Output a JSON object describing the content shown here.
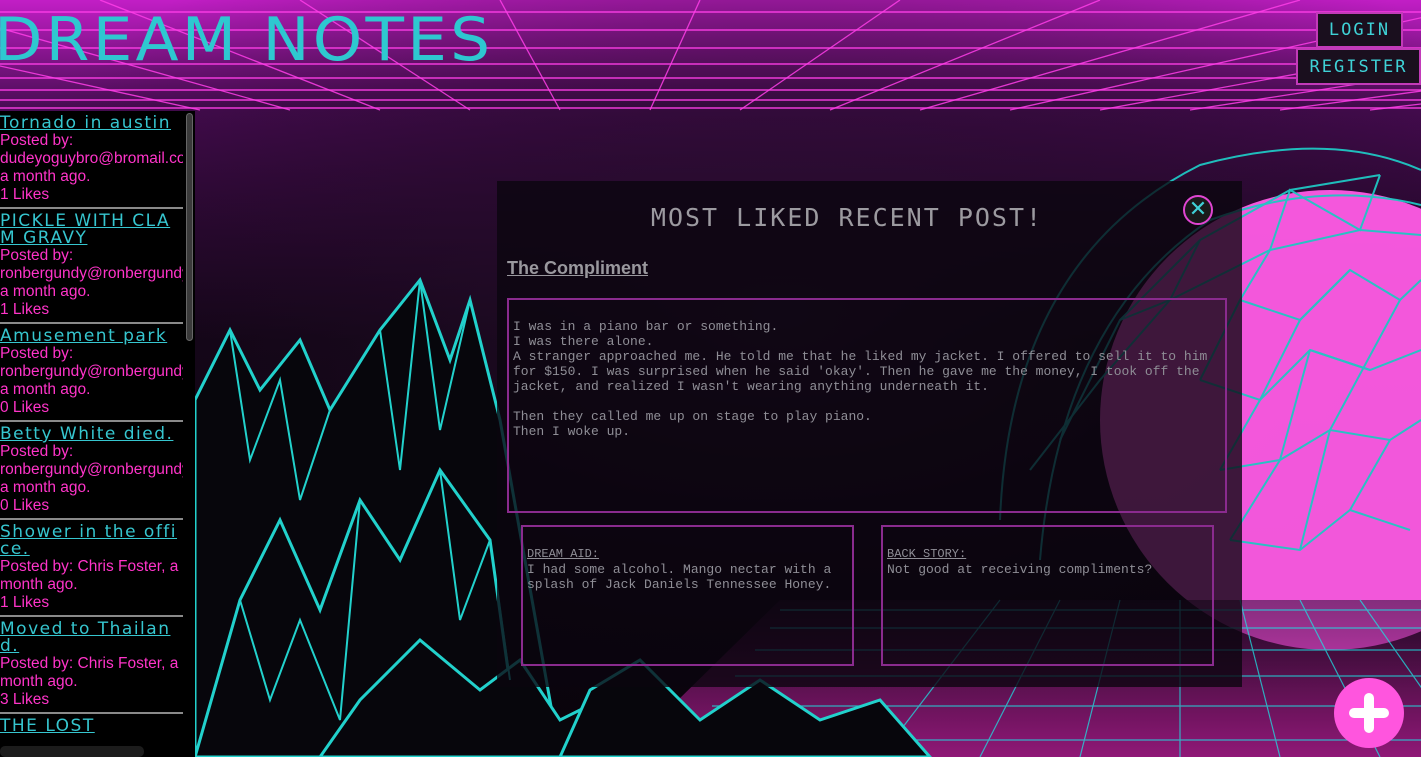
{
  "header": {
    "title": "DREAM NOTES",
    "login_label": "LOGIN",
    "register_label": "REGISTER"
  },
  "sidebar": {
    "posts": [
      {
        "title": "Tornado in austin",
        "meta": [
          "Posted by:",
          "dudeyoguybro@bromail.com,",
          "a month ago.",
          "1 Likes"
        ]
      },
      {
        "title": "PICKLE WITH CLAM GRAVY",
        "meta": [
          "Posted by:",
          "ronbergundy@ronbergundy.com,",
          "a month ago.",
          "1 Likes"
        ]
      },
      {
        "title": "Amusement park",
        "meta": [
          "Posted by:",
          "ronbergundy@ronbergundy.com,",
          "a month ago.",
          "0 Likes"
        ]
      },
      {
        "title": "Betty White died.",
        "meta": [
          "Posted by:",
          "ronbergundy@ronbergundy.com,",
          "a month ago.",
          "0 Likes"
        ]
      },
      {
        "title": "Shower in the office.",
        "meta": [
          "Posted by: Chris Foster, a month ago.",
          "1 Likes"
        ]
      },
      {
        "title": "Moved to Thailand.",
        "meta": [
          "Posted by: Chris Foster, a month ago.",
          "3 Likes"
        ]
      },
      {
        "title": "THE LOST",
        "meta": []
      }
    ]
  },
  "modal": {
    "heading": "MOST LIKED RECENT POST!",
    "close_icon": "close-icon",
    "post_title": "The Compliment",
    "dream_text": "I was in a piano bar or something.\nI was there alone.\nA stranger approached me. He told me that he liked my jacket. I offered to sell it to him for $150. I was surprised when he said 'okay'. Then he gave me the money, I took off the jacket, and realized I wasn't wearing anything underneath it.\n\nThen they called me up on stage to play piano.\nThen I woke up.",
    "dream_aid_label": "DREAM AID:",
    "dream_aid_text": "I had some alcohol. Mango nectar with a splash of Jack Daniels Tennessee Honey.",
    "back_story_label": "BACK STORY:",
    "back_story_text": "Not good at receiving compliments?"
  },
  "fab": {
    "icon": "plus-icon"
  },
  "colors": {
    "accent_cyan": "#2ec8d0",
    "accent_magenta": "#ff34c9",
    "border_purple": "#8a2b8e",
    "fab_pink": "#ff55de"
  }
}
